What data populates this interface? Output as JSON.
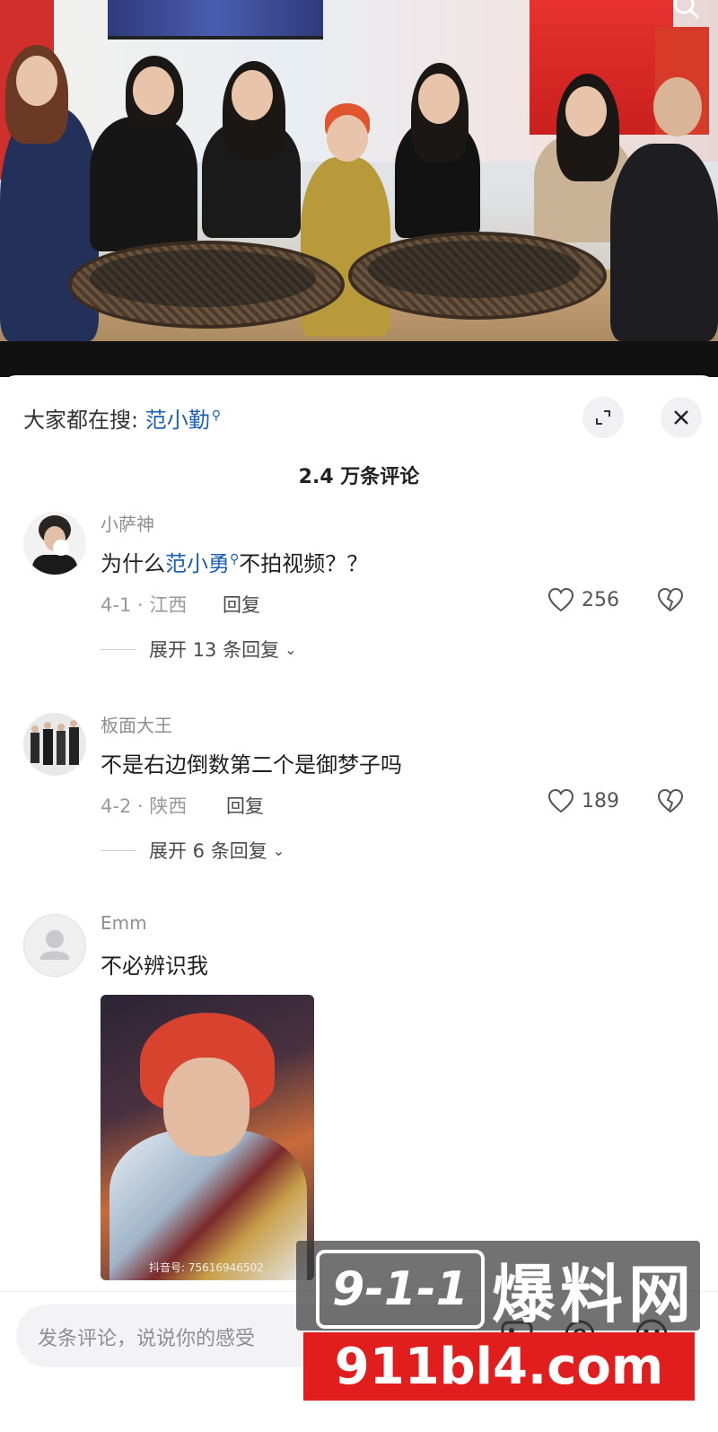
{
  "hot_search": {
    "prefix": "大家都在搜:",
    "term": "范小勤"
  },
  "comment_count": "2.4 万条评论",
  "comments": [
    {
      "username": "小萨神",
      "text_before": "为什么",
      "text_link": "范小勇",
      "text_after": "不拍视频？？",
      "meta": "4-1 · 江西",
      "reply": "回复",
      "likes": "256",
      "expand": "展开 13 条回复"
    },
    {
      "username": "板面大王",
      "text": "不是右边倒数第二个是御梦子吗",
      "meta": "4-2 · 陕西",
      "reply": "回复",
      "likes": "189",
      "expand": "展开 6 条回复"
    },
    {
      "username": "Emm",
      "text": "不必辨识我",
      "sticker_watermark": "抖音号: 75616946502"
    }
  ],
  "input": {
    "placeholder": "发条评论，说说你的感受"
  },
  "watermark": {
    "badge": "9-1-1",
    "brand": "爆料网",
    "url": "911bl4.com"
  },
  "colors": {
    "link": "#1c5fb8",
    "watermark_red": "#e21d1d"
  }
}
